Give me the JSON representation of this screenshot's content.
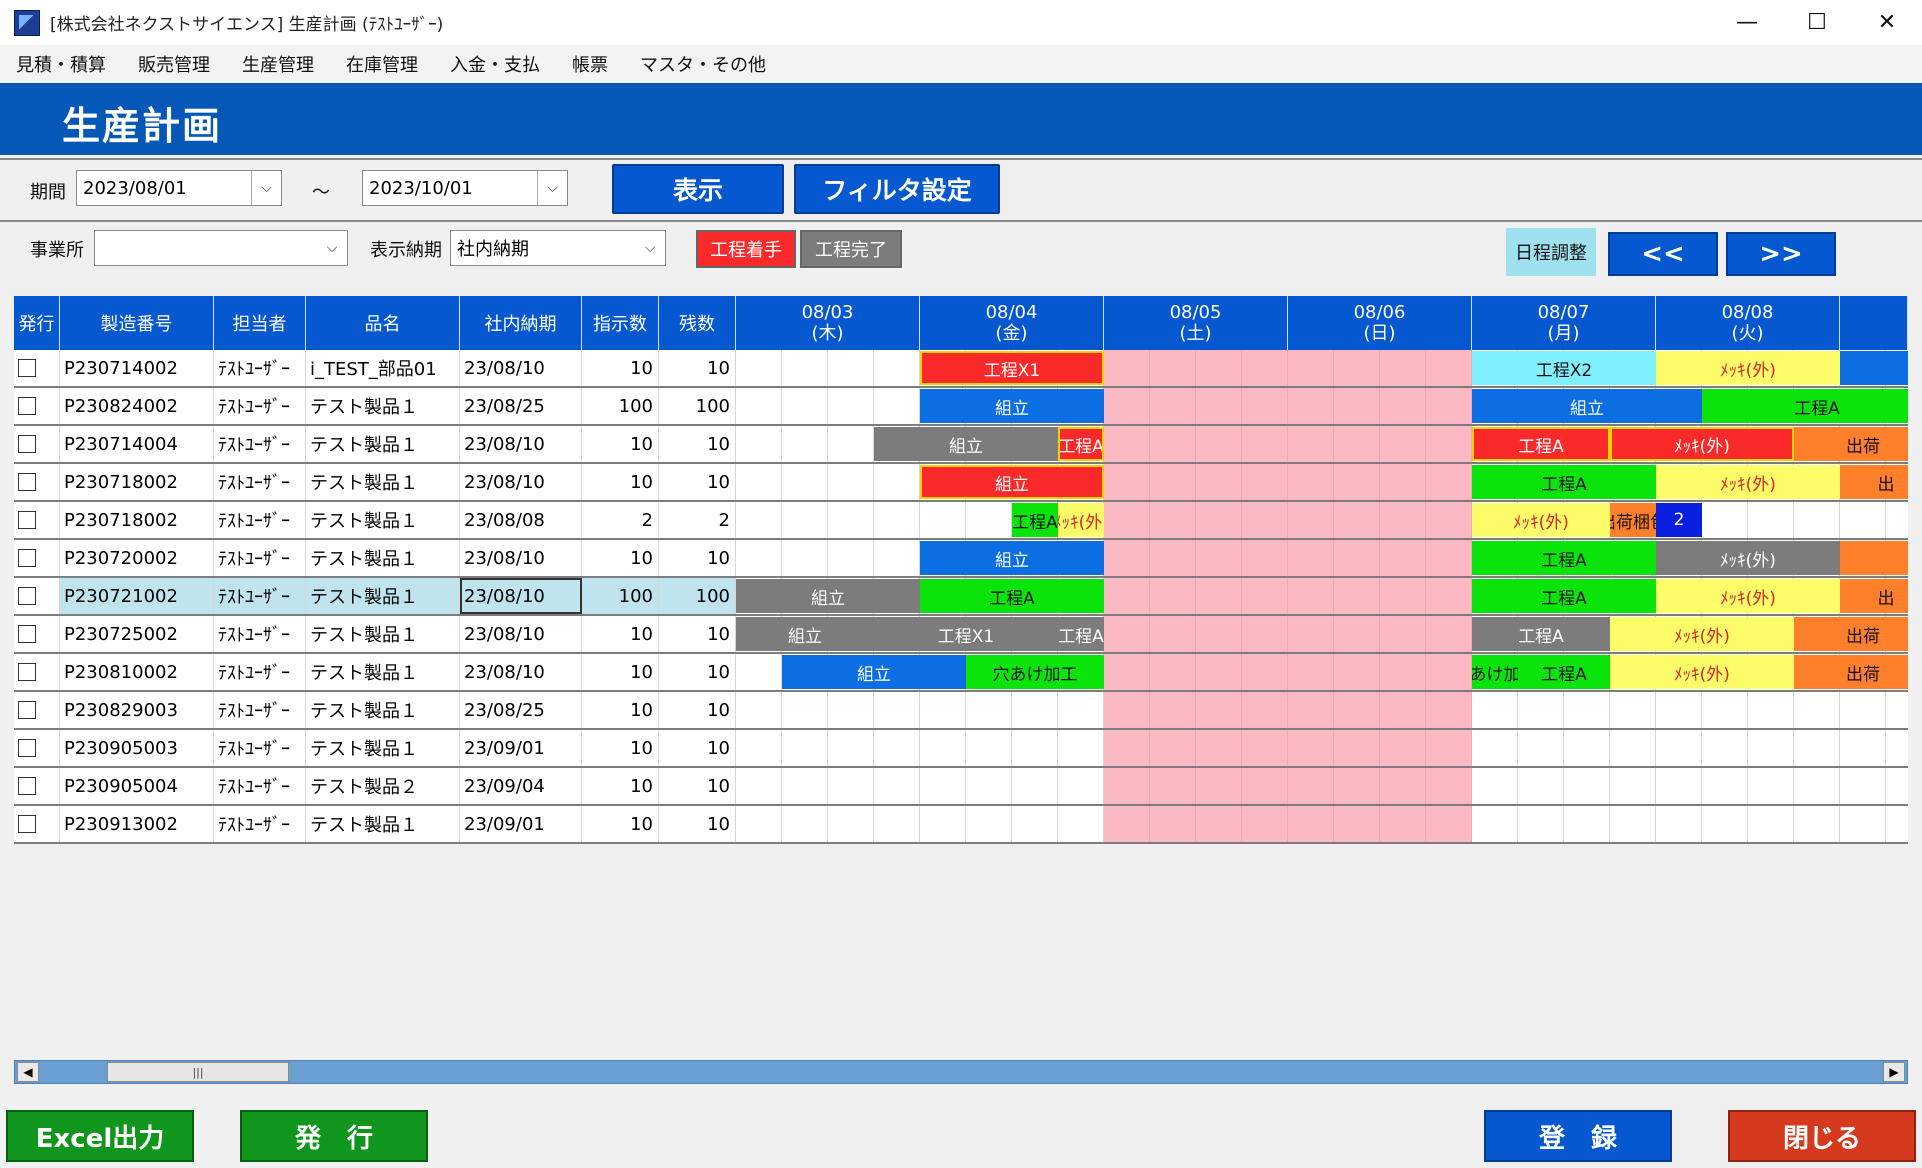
{
  "window": {
    "title": "[株式会社ネクストサイエンス] 生産計画 (ﾃｽﾄﾕｰｻﾞｰ)",
    "minimize": "—",
    "maximize": "☐",
    "close": "✕"
  },
  "menu": [
    "見積・積算",
    "販売管理",
    "生産管理",
    "在庫管理",
    "入金・支払",
    "帳票",
    "マスタ・その他"
  ],
  "page_title": "生産計画",
  "filters": {
    "period_label": "期間",
    "date_from": "2023/08/01",
    "tilde": "～",
    "date_to": "2023/10/01",
    "show_button": "表示",
    "filter_button": "フィルタ設定",
    "office_label": "事業所",
    "office_value": "",
    "delivery_label": "表示納期",
    "delivery_value": "社内納期",
    "legend_start": "工程着手",
    "legend_done": "工程完了",
    "schedule_adjust": "日程調整",
    "prev": "<<",
    "next": ">>"
  },
  "columns": [
    "発行",
    "製造番号",
    "担当者",
    "品名",
    "社内納期",
    "指示数",
    "残数"
  ],
  "dates": [
    {
      "date": "08/03",
      "dow": "(木)"
    },
    {
      "date": "08/04",
      "dow": "(金)"
    },
    {
      "date": "08/05",
      "dow": "(土)"
    },
    {
      "date": "08/06",
      "dow": "(日)"
    },
    {
      "date": "08/07",
      "dow": "(月)"
    },
    {
      "date": "08/08",
      "dow": "(火)"
    }
  ],
  "rows": [
    {
      "no": "P230714002",
      "tanto": "ﾃｽﾄﾕｰｻﾞｰ",
      "item": "i_TEST_部品01",
      "due": "23/08/10",
      "qty": "10",
      "rem": "10"
    },
    {
      "no": "P230824002",
      "tanto": "ﾃｽﾄﾕｰｻﾞｰ",
      "item": "テスト製品１",
      "due": "23/08/25",
      "qty": "100",
      "rem": "100"
    },
    {
      "no": "P230714004",
      "tanto": "ﾃｽﾄﾕｰｻﾞｰ",
      "item": "テスト製品１",
      "due": "23/08/10",
      "qty": "10",
      "rem": "10"
    },
    {
      "no": "P230718002",
      "tanto": "ﾃｽﾄﾕｰｻﾞｰ",
      "item": "テスト製品１",
      "due": "23/08/10",
      "qty": "10",
      "rem": "10"
    },
    {
      "no": "P230718002",
      "tanto": "ﾃｽﾄﾕｰｻﾞｰ",
      "item": "テスト製品１",
      "due": "23/08/08",
      "qty": "2",
      "rem": "2"
    },
    {
      "no": "P230720002",
      "tanto": "ﾃｽﾄﾕｰｻﾞｰ",
      "item": "テスト製品１",
      "due": "23/08/10",
      "qty": "10",
      "rem": "10"
    },
    {
      "no": "P230721002",
      "tanto": "ﾃｽﾄﾕｰｻﾞｰ",
      "item": "テスト製品１",
      "due": "23/08/10",
      "qty": "100",
      "rem": "100"
    },
    {
      "no": "P230725002",
      "tanto": "ﾃｽﾄﾕｰｻﾞｰ",
      "item": "テスト製品１",
      "due": "23/08/10",
      "qty": "10",
      "rem": "10"
    },
    {
      "no": "P230810002",
      "tanto": "ﾃｽﾄﾕｰｻﾞｰ",
      "item": "テスト製品１",
      "due": "23/08/10",
      "qty": "10",
      "rem": "10"
    },
    {
      "no": "P230829003",
      "tanto": "ﾃｽﾄﾕｰｻﾞｰ",
      "item": "テスト製品１",
      "due": "23/08/25",
      "qty": "10",
      "rem": "10"
    },
    {
      "no": "P230905003",
      "tanto": "ﾃｽﾄﾕｰｻﾞｰ",
      "item": "テスト製品１",
      "due": "23/09/01",
      "qty": "10",
      "rem": "10"
    },
    {
      "no": "P230905004",
      "tanto": "ﾃｽﾄﾕｰｻﾞｰ",
      "item": "テスト製品２",
      "due": "23/09/04",
      "qty": "10",
      "rem": "10"
    },
    {
      "no": "P230913002",
      "tanto": "ﾃｽﾄﾕｰｻﾞｰ",
      "item": "テスト製品１",
      "due": "23/09/01",
      "qty": "10",
      "rem": "10"
    }
  ],
  "tasks": [
    {
      "row": 0,
      "start": 4,
      "span": 4,
      "label": "工程X1",
      "style": "t-red"
    },
    {
      "row": 0,
      "start": 16,
      "span": 4,
      "label": "工程X2",
      "style": "t-cyan"
    },
    {
      "row": 0,
      "start": 20,
      "span": 4,
      "label": "ﾒｯｷ(外)",
      "style": "t-yellow"
    },
    {
      "row": 0,
      "start": 24,
      "span": 2,
      "label": "",
      "style": "t-blue"
    },
    {
      "row": 1,
      "start": 4,
      "span": 4,
      "label": "組立",
      "style": "t-blue"
    },
    {
      "row": 1,
      "start": 16,
      "span": 5,
      "label": "組立",
      "style": "t-blue"
    },
    {
      "row": 1,
      "start": 21,
      "span": 5,
      "label": "工程A",
      "style": "t-green"
    },
    {
      "row": 2,
      "start": 3,
      "span": 4,
      "label": "組立",
      "style": "t-gray"
    },
    {
      "row": 2,
      "start": 7,
      "span": 1,
      "label": "工程A",
      "style": "t-red"
    },
    {
      "row": 2,
      "start": 16,
      "span": 3,
      "label": "工程A",
      "style": "t-red"
    },
    {
      "row": 2,
      "start": 19,
      "span": 4,
      "label": "ﾒｯｷ(外)",
      "style": "t-red"
    },
    {
      "row": 2,
      "start": 23,
      "span": 3,
      "label": "出荷",
      "style": "t-orange"
    },
    {
      "row": 3,
      "start": 4,
      "span": 4,
      "label": "組立",
      "style": "t-red"
    },
    {
      "row": 3,
      "start": 16,
      "span": 4,
      "label": "工程A",
      "style": "t-green"
    },
    {
      "row": 3,
      "start": 20,
      "span": 4,
      "label": "ﾒｯｷ(外)",
      "style": "t-yellow"
    },
    {
      "row": 3,
      "start": 24,
      "span": 2,
      "label": "出",
      "style": "t-orange"
    },
    {
      "row": 4,
      "start": 6,
      "span": 1,
      "label": "工程A",
      "style": "t-green"
    },
    {
      "row": 4,
      "start": 7,
      "span": 1,
      "label": "ﾒｯｷ(外)",
      "style": "t-yellow"
    },
    {
      "row": 4,
      "start": 16,
      "span": 3,
      "label": "ﾒｯｷ(外)",
      "style": "t-yellow"
    },
    {
      "row": 4,
      "start": 19,
      "span": 1,
      "label": "出荷梱包",
      "style": "t-orange"
    },
    {
      "row": 4,
      "start": 20,
      "span": 1,
      "label": "2",
      "style": "t-navy"
    },
    {
      "row": 5,
      "start": 4,
      "span": 4,
      "label": "組立",
      "style": "t-blue"
    },
    {
      "row": 5,
      "start": 16,
      "span": 4,
      "label": "工程A",
      "style": "t-green"
    },
    {
      "row": 5,
      "start": 20,
      "span": 4,
      "label": "ﾒｯｷ(外)",
      "style": "t-gray"
    },
    {
      "row": 5,
      "start": 24,
      "span": 2,
      "label": "",
      "style": "t-orange"
    },
    {
      "row": 6,
      "start": 0,
      "span": 4,
      "label": "組立",
      "style": "t-gray"
    },
    {
      "row": 6,
      "start": 4,
      "span": 4,
      "label": "工程A",
      "style": "t-green"
    },
    {
      "row": 6,
      "start": 16,
      "span": 4,
      "label": "工程A",
      "style": "t-green"
    },
    {
      "row": 6,
      "start": 20,
      "span": 4,
      "label": "ﾒｯｷ(外)",
      "style": "t-yellow"
    },
    {
      "row": 6,
      "start": 24,
      "span": 2,
      "label": "出",
      "style": "t-orange"
    },
    {
      "row": 7,
      "start": 0,
      "span": 3,
      "label": "組立",
      "style": "t-gray"
    },
    {
      "row": 7,
      "start": 3,
      "span": 4,
      "label": "工程X1",
      "style": "t-gray"
    },
    {
      "row": 7,
      "start": 7,
      "span": 1,
      "label": "工程A",
      "style": "t-gray"
    },
    {
      "row": 7,
      "start": 16,
      "span": 3,
      "label": "工程A",
      "style": "t-gray"
    },
    {
      "row": 7,
      "start": 19,
      "span": 4,
      "label": "ﾒｯｷ(外)",
      "style": "t-yellow"
    },
    {
      "row": 7,
      "start": 23,
      "span": 3,
      "label": "出荷",
      "style": "t-orange"
    },
    {
      "row": 8,
      "start": 1,
      "span": 4,
      "label": "組立",
      "style": "t-blue"
    },
    {
      "row": 8,
      "start": 5,
      "span": 3,
      "label": "穴あけ加工",
      "style": "t-green"
    },
    {
      "row": 8,
      "start": 16,
      "span": 1,
      "label": "穴あけ加工",
      "style": "t-green"
    },
    {
      "row": 8,
      "start": 17,
      "span": 2,
      "label": "工程A",
      "style": "t-green"
    },
    {
      "row": 8,
      "start": 19,
      "span": 4,
      "label": "ﾒｯｷ(外)",
      "style": "t-yellow"
    },
    {
      "row": 8,
      "start": 23,
      "span": 3,
      "label": "出荷",
      "style": "t-orange"
    }
  ],
  "bottom": {
    "excel": "Excel出力",
    "issue": "発　行",
    "register": "登　録",
    "close": "閉じる"
  },
  "scroll_thumb": "|||"
}
